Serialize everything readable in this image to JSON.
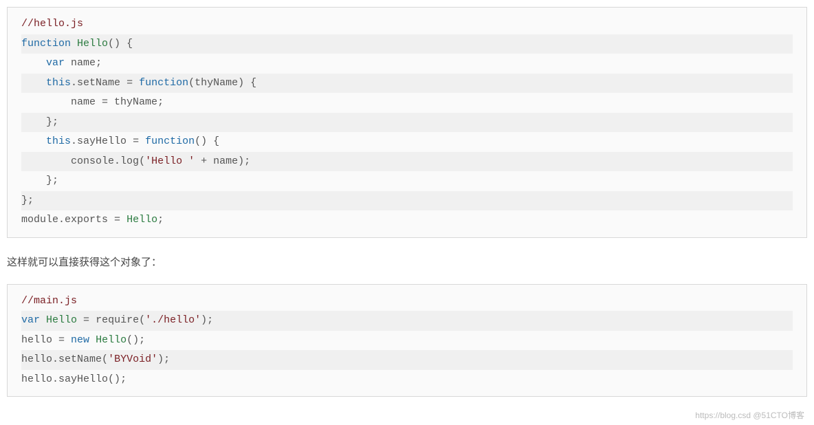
{
  "block1": {
    "lines": [
      {
        "stripe": false,
        "tokens": [
          {
            "cls": "c-comment",
            "t": "//hello.js"
          }
        ]
      },
      {
        "stripe": true,
        "tokens": [
          {
            "cls": "c-keyword",
            "t": "function"
          },
          {
            "cls": "c-plain",
            "t": " "
          },
          {
            "cls": "c-func",
            "t": "Hello"
          },
          {
            "cls": "c-paren",
            "t": "()"
          },
          {
            "cls": "c-plain",
            "t": " {"
          }
        ]
      },
      {
        "stripe": false,
        "tokens": [
          {
            "cls": "c-plain",
            "t": "    "
          },
          {
            "cls": "c-keyword",
            "t": "var"
          },
          {
            "cls": "c-plain",
            "t": " "
          },
          {
            "cls": "c-ident",
            "t": "name"
          },
          {
            "cls": "c-plain",
            "t": ";"
          }
        ]
      },
      {
        "stripe": true,
        "tokens": [
          {
            "cls": "c-plain",
            "t": "    "
          },
          {
            "cls": "c-keyword",
            "t": "this"
          },
          {
            "cls": "c-plain",
            "t": "."
          },
          {
            "cls": "c-ident",
            "t": "setName"
          },
          {
            "cls": "c-plain",
            "t": " = "
          },
          {
            "cls": "c-keyword",
            "t": "function"
          },
          {
            "cls": "c-paren",
            "t": "("
          },
          {
            "cls": "c-ident",
            "t": "thyName"
          },
          {
            "cls": "c-paren",
            "t": ")"
          },
          {
            "cls": "c-plain",
            "t": " {"
          }
        ]
      },
      {
        "stripe": false,
        "tokens": [
          {
            "cls": "c-plain",
            "t": "        "
          },
          {
            "cls": "c-ident",
            "t": "name"
          },
          {
            "cls": "c-plain",
            "t": " = "
          },
          {
            "cls": "c-ident",
            "t": "thyName"
          },
          {
            "cls": "c-plain",
            "t": ";"
          }
        ]
      },
      {
        "stripe": true,
        "tokens": [
          {
            "cls": "c-plain",
            "t": "    };"
          }
        ]
      },
      {
        "stripe": false,
        "tokens": [
          {
            "cls": "c-plain",
            "t": "    "
          },
          {
            "cls": "c-keyword",
            "t": "this"
          },
          {
            "cls": "c-plain",
            "t": "."
          },
          {
            "cls": "c-ident",
            "t": "sayHello"
          },
          {
            "cls": "c-plain",
            "t": " = "
          },
          {
            "cls": "c-keyword",
            "t": "function"
          },
          {
            "cls": "c-paren",
            "t": "()"
          },
          {
            "cls": "c-plain",
            "t": " {"
          }
        ]
      },
      {
        "stripe": true,
        "tokens": [
          {
            "cls": "c-plain",
            "t": "        "
          },
          {
            "cls": "c-ident",
            "t": "console"
          },
          {
            "cls": "c-plain",
            "t": "."
          },
          {
            "cls": "c-ident",
            "t": "log"
          },
          {
            "cls": "c-paren",
            "t": "("
          },
          {
            "cls": "c-string",
            "t": "'Hello '"
          },
          {
            "cls": "c-plain",
            "t": " + "
          },
          {
            "cls": "c-ident",
            "t": "name"
          },
          {
            "cls": "c-paren",
            "t": ")"
          },
          {
            "cls": "c-plain",
            "t": ";"
          }
        ]
      },
      {
        "stripe": false,
        "tokens": [
          {
            "cls": "c-plain",
            "t": "    };"
          }
        ]
      },
      {
        "stripe": true,
        "tokens": [
          {
            "cls": "c-plain",
            "t": "};"
          }
        ]
      },
      {
        "stripe": false,
        "tokens": [
          {
            "cls": "c-ident",
            "t": "module"
          },
          {
            "cls": "c-plain",
            "t": "."
          },
          {
            "cls": "c-ident",
            "t": "exports"
          },
          {
            "cls": "c-plain",
            "t": " = "
          },
          {
            "cls": "c-func",
            "t": "Hello"
          },
          {
            "cls": "c-plain",
            "t": ";"
          }
        ]
      }
    ]
  },
  "prose1": "这样就可以直接获得这个对象了：",
  "block2": {
    "lines": [
      {
        "stripe": false,
        "tokens": [
          {
            "cls": "c-comment",
            "t": "//main.js"
          }
        ]
      },
      {
        "stripe": true,
        "tokens": [
          {
            "cls": "c-keyword",
            "t": "var"
          },
          {
            "cls": "c-plain",
            "t": " "
          },
          {
            "cls": "c-func",
            "t": "Hello"
          },
          {
            "cls": "c-plain",
            "t": " = "
          },
          {
            "cls": "c-ident",
            "t": "require"
          },
          {
            "cls": "c-paren",
            "t": "("
          },
          {
            "cls": "c-string",
            "t": "'./hello'"
          },
          {
            "cls": "c-paren",
            "t": ")"
          },
          {
            "cls": "c-plain",
            "t": ";"
          }
        ]
      },
      {
        "stripe": false,
        "tokens": [
          {
            "cls": "c-ident",
            "t": "hello"
          },
          {
            "cls": "c-plain",
            "t": " = "
          },
          {
            "cls": "c-keyword",
            "t": "new"
          },
          {
            "cls": "c-plain",
            "t": " "
          },
          {
            "cls": "c-func",
            "t": "Hello"
          },
          {
            "cls": "c-paren",
            "t": "()"
          },
          {
            "cls": "c-plain",
            "t": ";"
          }
        ]
      },
      {
        "stripe": true,
        "tokens": [
          {
            "cls": "c-ident",
            "t": "hello"
          },
          {
            "cls": "c-plain",
            "t": "."
          },
          {
            "cls": "c-ident",
            "t": "setName"
          },
          {
            "cls": "c-paren",
            "t": "("
          },
          {
            "cls": "c-string",
            "t": "'BYVoid'"
          },
          {
            "cls": "c-paren",
            "t": ")"
          },
          {
            "cls": "c-plain",
            "t": ";"
          }
        ]
      },
      {
        "stripe": false,
        "tokens": [
          {
            "cls": "c-ident",
            "t": "hello"
          },
          {
            "cls": "c-plain",
            "t": "."
          },
          {
            "cls": "c-ident",
            "t": "sayHello"
          },
          {
            "cls": "c-paren",
            "t": "()"
          },
          {
            "cls": "c-plain",
            "t": ";"
          }
        ]
      }
    ]
  },
  "watermark": "https://blog.csd @51CTO博客"
}
